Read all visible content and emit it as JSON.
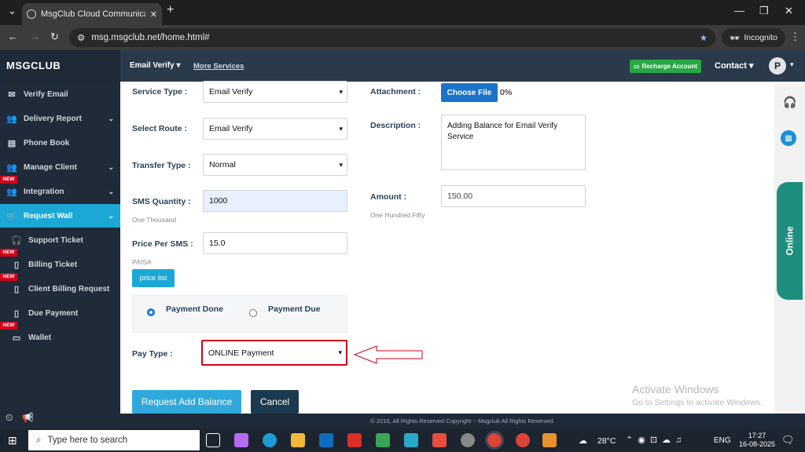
{
  "browser": {
    "tab_title": "MsgClub Cloud Communication",
    "url": "msg.msgclub.net/home.html#",
    "incognito": "Incognito"
  },
  "header": {
    "brand": "MSGCLUB",
    "menu_email": "Email Verify",
    "menu_more": "More Services",
    "recharge": "Recharge Account",
    "contact": "Contact",
    "avatar": "P"
  },
  "sidebar": {
    "items": [
      {
        "label": "Verify Email",
        "icon": "envelope-icon",
        "new": false,
        "chevron": false
      },
      {
        "label": "Delivery Report",
        "icon": "users-icon",
        "new": false,
        "chevron": true
      },
      {
        "label": "Phone Book",
        "icon": "book-icon",
        "new": false,
        "chevron": false
      },
      {
        "label": "Manage Client",
        "icon": "users-icon",
        "new": false,
        "chevron": true
      },
      {
        "label": "Integration",
        "icon": "users-icon",
        "new": true,
        "chevron": true
      },
      {
        "label": "Request Wall",
        "icon": "cart-icon",
        "new": false,
        "chevron": true,
        "active": true
      },
      {
        "label": "Support Ticket",
        "icon": "headset-icon",
        "new": false,
        "chevron": false
      },
      {
        "label": "Billing Ticket",
        "icon": "receipt-icon",
        "new": true,
        "chevron": false
      },
      {
        "label": "Client Billing Request",
        "icon": "receipt-icon",
        "new": true,
        "chevron": false
      },
      {
        "label": "Due Payment",
        "icon": "receipt-icon",
        "new": false,
        "chevron": false
      },
      {
        "label": "Wallet",
        "icon": "wallet-icon",
        "new": true,
        "chevron": false
      }
    ],
    "new_badge": "NEW"
  },
  "form": {
    "service_type_label": "Service Type :",
    "service_type_value": "Email Verify",
    "select_route_label": "Select Route :",
    "select_route_value": "Email Verify",
    "transfer_type_label": "Transfer Type :",
    "transfer_type_value": "Normal",
    "sms_qty_label": "SMS Quantity :",
    "sms_qty_value": "1000",
    "sms_qty_words": "One Thousand",
    "price_label": "Price Per SMS :",
    "price_value": "15.0",
    "price_unit": "PAISA",
    "price_list": "price list",
    "payment_done": "Payment Done",
    "payment_due": "Payment Due",
    "pay_type_label": "Pay Type :",
    "pay_type_value": "ONLINE Payment",
    "attachment_label": "Attachment :",
    "choose_file": "Choose File",
    "upload_percent": "0%",
    "description_label": "Description :",
    "description_value": "Adding Balance for Email Verify Service",
    "amount_label": "Amount :",
    "amount_value": "150.00",
    "amount_words": "One Hundred Fifty",
    "submit": "Request Add Balance",
    "cancel": "Cancel"
  },
  "side_tab": "Online",
  "watermark": {
    "title": "Activate Windows",
    "sub": "Go to Settings to activate Windows."
  },
  "footer": "© 2016, All Rights Reserved Copyright :- Msgclub All Rights Reserved.",
  "taskbar": {
    "search": "Type here to search",
    "temp": "28°C",
    "lang": "ENG",
    "time": "17:27",
    "date": "16-08-2025"
  }
}
